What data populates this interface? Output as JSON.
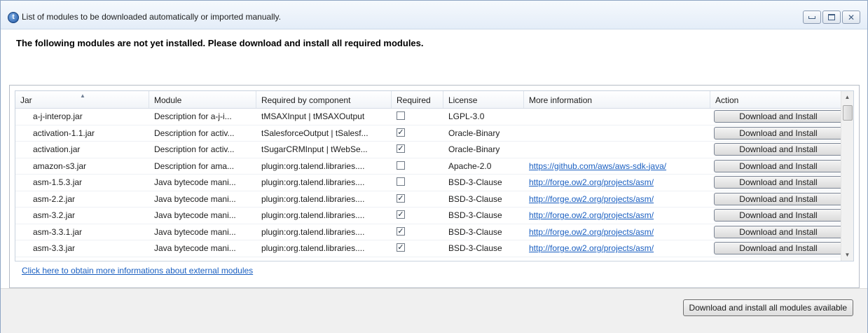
{
  "window": {
    "title": "List of modules to be downloaded automatically or imported manually.",
    "icon": "talend-app-icon"
  },
  "heading": "The following modules are not yet installed. Please download and install all required modules.",
  "table": {
    "columns": [
      "Jar",
      "Module",
      "Required by component",
      "Required",
      "License",
      "More information",
      "Action"
    ],
    "sort_column": "Jar",
    "rows": [
      {
        "jar": "a-j-interop.jar",
        "module": "Description for a-j-i...",
        "required_by": "tMSAXInput | tMSAXOutput",
        "required": false,
        "license": "LGPL-3.0",
        "more_info": "",
        "action": "Download and Install"
      },
      {
        "jar": "activation-1.1.jar",
        "module": "Description for activ...",
        "required_by": "tSalesforceOutput | tSalesf...",
        "required": true,
        "license": "Oracle-Binary",
        "more_info": "",
        "action": "Download and Install"
      },
      {
        "jar": "activation.jar",
        "module": "Description for activ...",
        "required_by": "tSugarCRMInput | tWebSe...",
        "required": true,
        "license": "Oracle-Binary",
        "more_info": "",
        "action": "Download and Install"
      },
      {
        "jar": "amazon-s3.jar",
        "module": "Description for ama...",
        "required_by": "plugin:org.talend.libraries....",
        "required": false,
        "license": "Apache-2.0",
        "more_info": "https://github.com/aws/aws-sdk-java/",
        "action": "Download and Install"
      },
      {
        "jar": "asm-1.5.3.jar",
        "module": "Java bytecode mani...",
        "required_by": "plugin:org.talend.libraries....",
        "required": false,
        "license": "BSD-3-Clause",
        "more_info": "http://forge.ow2.org/projects/asm/",
        "action": "Download and Install"
      },
      {
        "jar": "asm-2.2.jar",
        "module": "Java bytecode mani...",
        "required_by": "plugin:org.talend.libraries....",
        "required": true,
        "license": "BSD-3-Clause",
        "more_info": "http://forge.ow2.org/projects/asm/",
        "action": "Download and Install"
      },
      {
        "jar": "asm-3.2.jar",
        "module": "Java bytecode mani...",
        "required_by": "plugin:org.talend.libraries....",
        "required": true,
        "license": "BSD-3-Clause",
        "more_info": "http://forge.ow2.org/projects/asm/",
        "action": "Download and Install"
      },
      {
        "jar": "asm-3.3.1.jar",
        "module": "Java bytecode mani...",
        "required_by": "plugin:org.talend.libraries....",
        "required": true,
        "license": "BSD-3-Clause",
        "more_info": "http://forge.ow2.org/projects/asm/",
        "action": "Download and Install"
      },
      {
        "jar": "asm-3.3.jar",
        "module": "Java bytecode mani...",
        "required_by": "plugin:org.talend.libraries....",
        "required": true,
        "license": "BSD-3-Clause",
        "more_info": "http://forge.ow2.org/projects/asm/",
        "action": "Download and Install"
      }
    ]
  },
  "info_link": "Click here to obtain more informations about external modules",
  "install_all_label": "Download and install all modules available"
}
